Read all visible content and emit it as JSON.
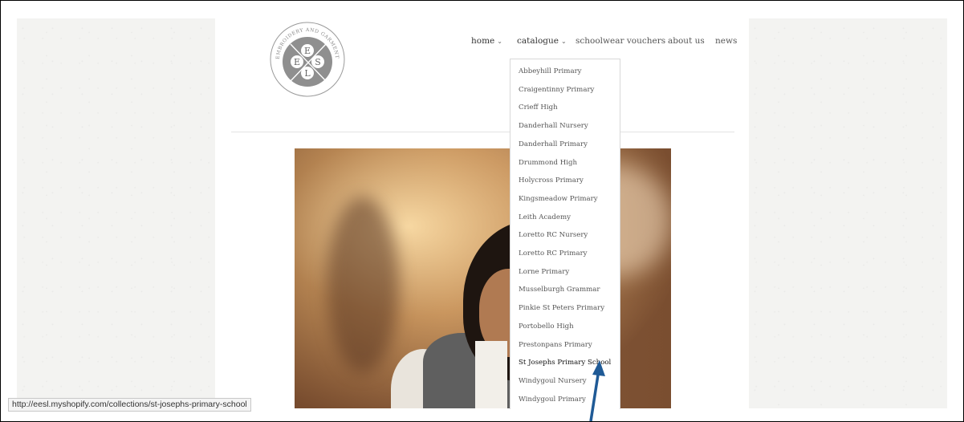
{
  "logo": {
    "arc_text": "EMBROIDERY AND GARMENT PRINTING SPECIALIST",
    "letters": [
      "E",
      "E",
      "S",
      "L"
    ]
  },
  "nav": {
    "home": "home",
    "catalogue": "catalogue",
    "vouchers": "schoolwear vouchers",
    "about": "about us",
    "news": "news",
    "chevron": "⌄"
  },
  "catalogue_menu": {
    "items": [
      "Abbeyhill Primary",
      "Craigentinny Primary",
      "Crieff High",
      "Danderhall Nursery",
      "Danderhall Primary",
      "Drummond High",
      "Holycross Primary",
      "Kingsmeadow Primary",
      "Leith Academy",
      "Loretto RC Nursery",
      "Loretto RC Primary",
      "Lorne Primary",
      "Musselburgh Grammar",
      "Pinkie St Peters Primary",
      "Portobello High",
      "Prestonpans Primary",
      "St Josephs Primary School",
      "Windygoul Nursery",
      "Windygoul Primary"
    ],
    "hovered": "St Josephs Primary School"
  },
  "status_bar": {
    "url": "http://eesl.myshopify.com/collections/st-josephs-primary-school"
  },
  "colors": {
    "annotation_arrow": "#1f5a96",
    "nav_text": "#555555",
    "background_texture": "#f3f3f1"
  }
}
